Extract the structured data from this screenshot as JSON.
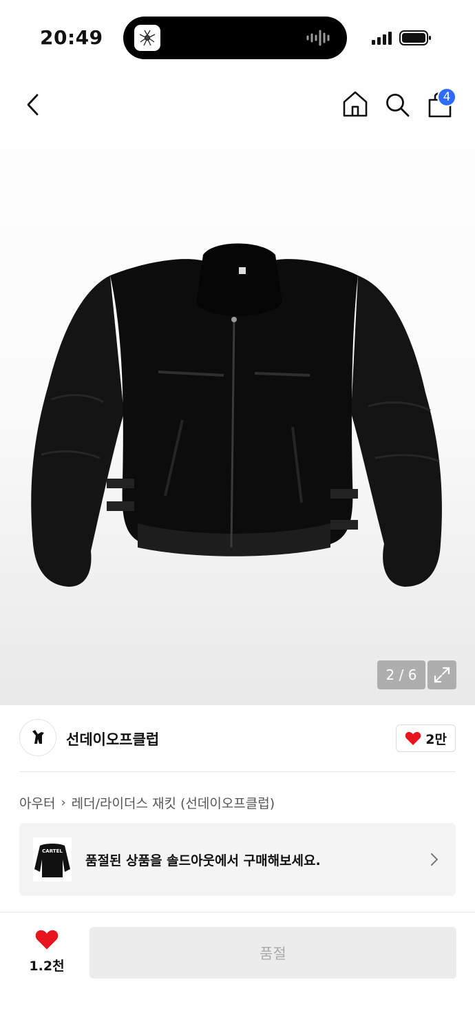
{
  "status_bar": {
    "time": "20:49"
  },
  "header": {
    "cart_count": "4"
  },
  "gallery": {
    "pager": "2 / 6"
  },
  "brand": {
    "name": "선데이오프클럽",
    "like_count": "2만"
  },
  "breadcrumb": {
    "category": "아우터",
    "subcategory": "레더/라이더스 재킷 (선데이오프클럽)"
  },
  "soldout_card": {
    "message": "품절된 상품을 솔드아웃에서 구매해보세요.",
    "thumb_text": "CARTEL"
  },
  "bottom_bar": {
    "wish_count": "1.2천",
    "buy_label": "품절"
  },
  "colors": {
    "badge": "#2f6bff",
    "heart": "#e8141e",
    "disabled_bg": "#ececec"
  }
}
